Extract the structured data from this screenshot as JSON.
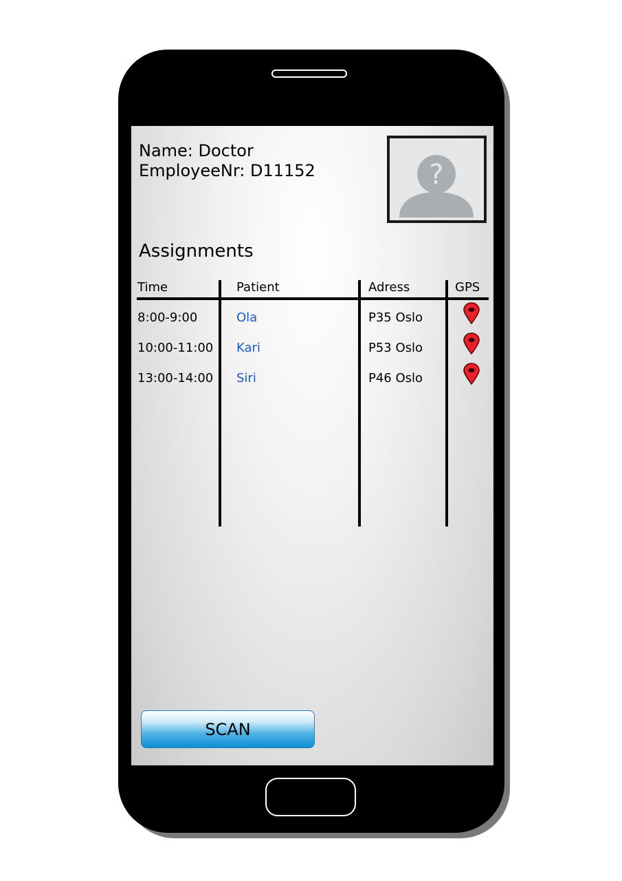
{
  "profile": {
    "name_line": "Name: Doctor",
    "employee_line": "EmployeeNr: D11152",
    "avatar_icon": "unknown-user-icon"
  },
  "assignments": {
    "title": "Assignments",
    "columns": {
      "time": "Time",
      "patient": "Patient",
      "address": "Adress",
      "gps": "GPS"
    },
    "rows": [
      {
        "time": "8:00-9:00",
        "patient": "Ola",
        "address": "P35 Oslo",
        "gps_icon": "map-pin-icon"
      },
      {
        "time": "10:00-11:00",
        "patient": "Kari",
        "address": "P53 Oslo",
        "gps_icon": "map-pin-icon"
      },
      {
        "time": "13:00-14:00",
        "patient": "Siri",
        "address": "P46 Oslo",
        "gps_icon": "map-pin-icon"
      }
    ]
  },
  "actions": {
    "scan_label": "SCAN"
  },
  "colors": {
    "patient_link": "#1a5bc4",
    "gps_pin": "#e8202a",
    "scan_button": "#0f8fd3"
  }
}
